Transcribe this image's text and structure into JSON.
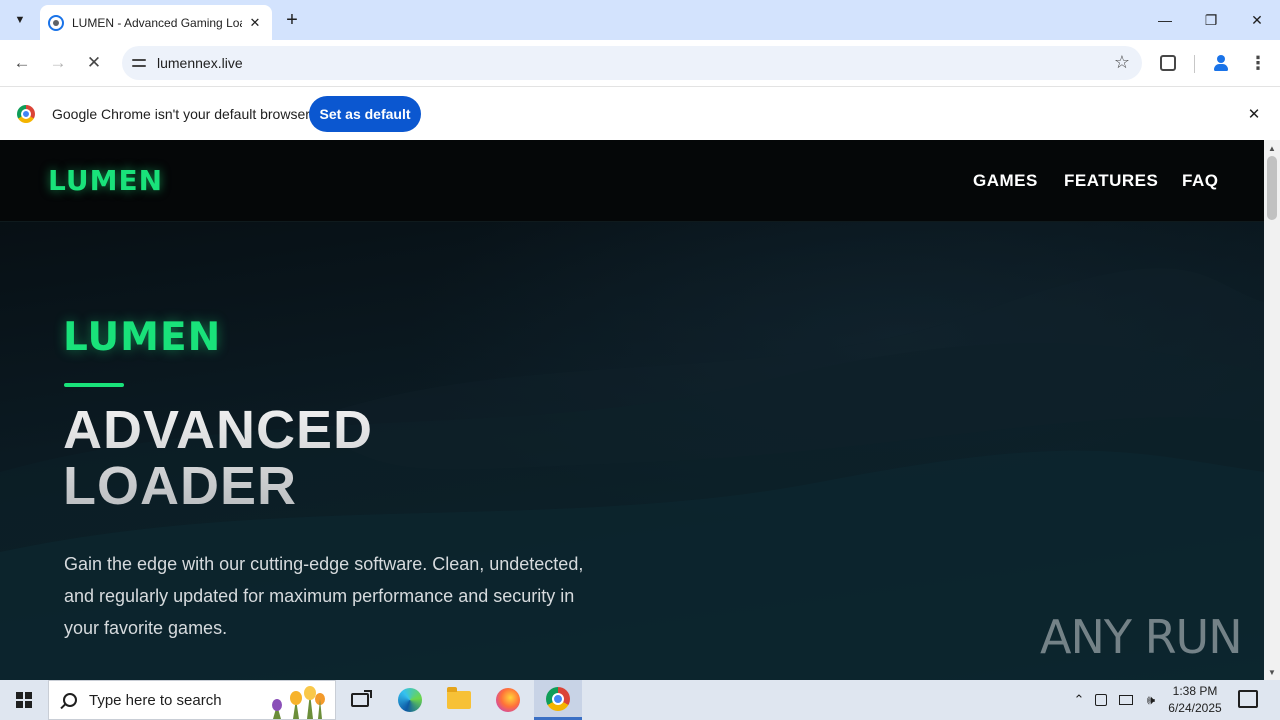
{
  "browser": {
    "tab": {
      "title": "LUMEN - Advanced Gaming Loader",
      "close_glyph": "✕"
    },
    "new_tab_glyph": "+",
    "window": {
      "minimize_glyph": "—",
      "restore_glyph": "❐",
      "close_glyph": "✕"
    },
    "toolbar": {
      "back_glyph": "←",
      "forward_glyph": "→",
      "stop_glyph": "✕",
      "url": "lumennex.live",
      "star_glyph": "☆",
      "menu_glyph": "⋮"
    },
    "infobar": {
      "message": "Google Chrome isn't your default browser",
      "button_label": "Set as default",
      "close_glyph": "✕"
    }
  },
  "site": {
    "logo": "LUMEN",
    "nav": [
      "GAMES",
      "FEATURES",
      "FAQ"
    ],
    "hero": {
      "brand": "LUMEN",
      "title_line1": "ADVANCED",
      "title_line2": "LOADER",
      "description": "Gain the edge with our cutting-edge software. Clean, undetected, and regularly updated for maximum performance and security in your favorite games."
    },
    "watermark": "ANY RUN"
  },
  "taskbar": {
    "search_placeholder": "Type here to search",
    "time": "1:38 PM",
    "date": "6/24/2025",
    "tray_chevron": "⌃",
    "volume_glyph": "🕪"
  },
  "colors": {
    "accent_green": "#19e27a",
    "chrome_blue": "#0b57d0",
    "tab_strip": "#d3e3fd"
  }
}
